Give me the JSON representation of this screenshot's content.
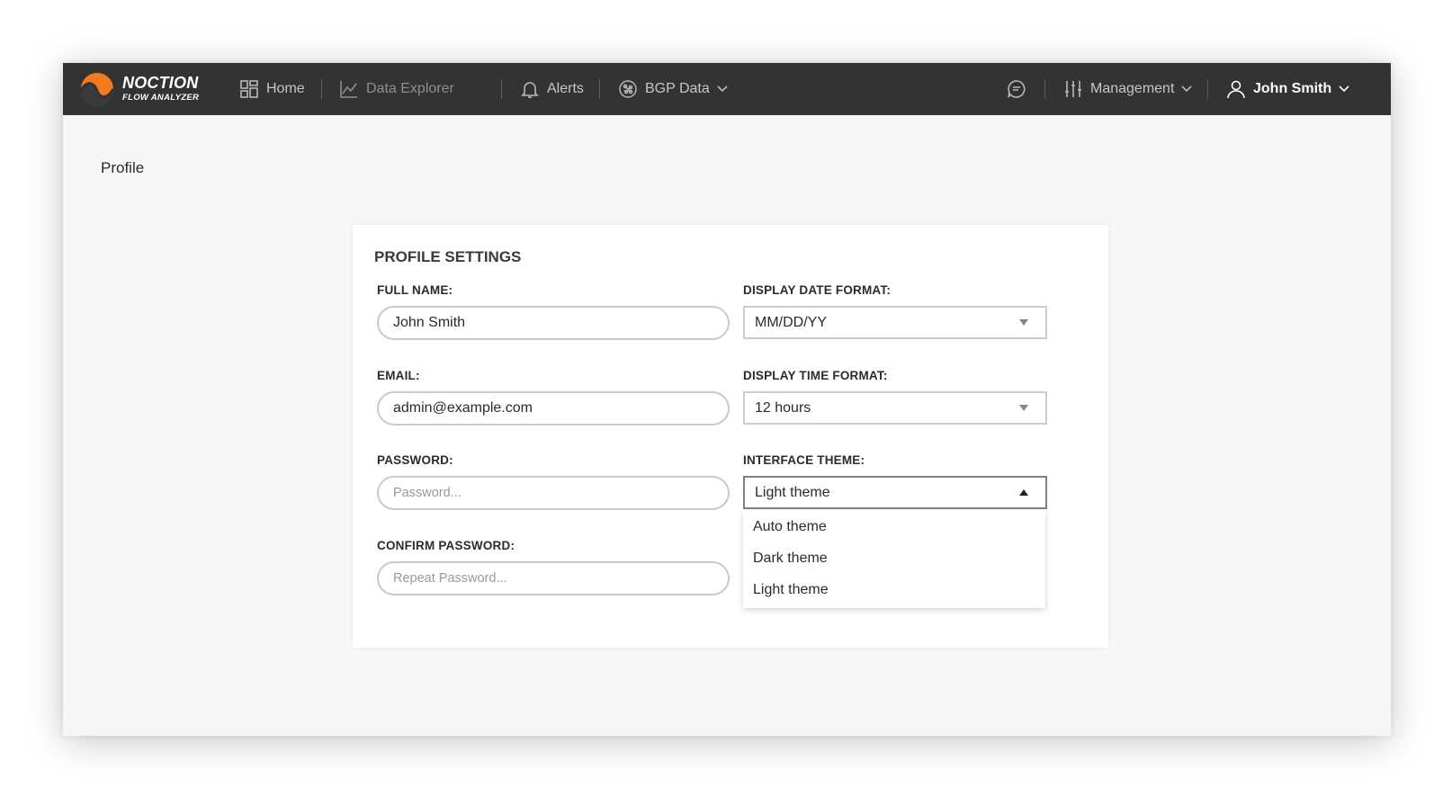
{
  "brand": {
    "name": "NOCTION",
    "product": "FLOW ANALYZER",
    "accent_color": "#f47a20"
  },
  "nav": {
    "home": {
      "label": "Home",
      "icon": "grid-icon"
    },
    "data_explorer": {
      "label": "Data Explorer",
      "icon": "line-chart-icon"
    },
    "alerts": {
      "label": "Alerts",
      "icon": "bell-icon"
    },
    "bgp_data": {
      "label": "BGP Data",
      "icon": "network-globe-icon"
    },
    "chat": {
      "icon": "chat-bubble-icon"
    },
    "management": {
      "label": "Management",
      "icon": "sliders-icon"
    },
    "user": {
      "label": "John Smith",
      "icon": "user-icon"
    }
  },
  "page": {
    "title": "Profile"
  },
  "profile_settings": {
    "title": "PROFILE SETTINGS",
    "full_name": {
      "label": "FULL NAME:",
      "value": "John Smith"
    },
    "email": {
      "label": "EMAIL:",
      "value": "admin@example.com"
    },
    "password": {
      "label": "PASSWORD:",
      "placeholder": "Password..."
    },
    "confirm_password": {
      "label": "CONFIRM PASSWORD:",
      "placeholder": "Repeat Password..."
    },
    "date_format": {
      "label": "DISPLAY DATE FORMAT:",
      "value": "MM/DD/YY"
    },
    "time_format": {
      "label": "DISPLAY TIME FORMAT:",
      "value": "12 hours"
    },
    "theme": {
      "label": "INTERFACE THEME:",
      "value": "Light theme",
      "options": [
        "Auto theme",
        "Dark theme",
        "Light theme"
      ]
    }
  }
}
